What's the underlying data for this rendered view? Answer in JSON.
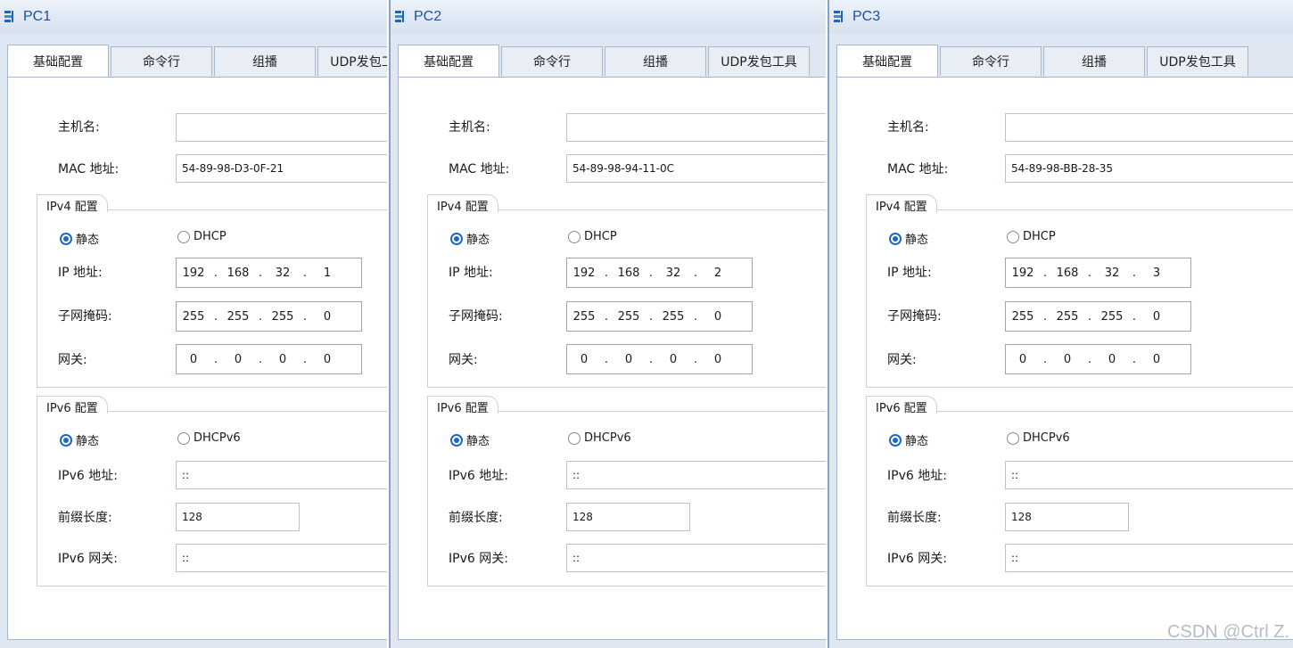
{
  "tabs": [
    "基础配置",
    "命令行",
    "组播",
    "UDP发包工具"
  ],
  "labels": {
    "hostname": "主机名:",
    "mac": "MAC 地址:",
    "ipv4_group": "IPv4 配置",
    "static": "静态",
    "dhcp": "DHCP",
    "ip": "IP 地址:",
    "mask": "子网掩码:",
    "gateway": "网关:",
    "ipv6_group": "IPv6 配置",
    "dhcpv6": "DHCPv6",
    "ipv6_addr": "IPv6 地址:",
    "prefix_len": "前缀长度:",
    "ipv6_gw": "IPv6 网关:"
  },
  "dot": ".",
  "windows": [
    {
      "title": "PC1",
      "hostname": "",
      "mac": "54-89-98-D3-0F-21",
      "ipv4_mode": "static",
      "ip": [
        "192",
        "168",
        "32",
        "1"
      ],
      "mask": [
        "255",
        "255",
        "255",
        "0"
      ],
      "gateway": [
        "0",
        "0",
        "0",
        "0"
      ],
      "ipv6_mode": "static",
      "ipv6_addr": "::",
      "prefix_len": "128",
      "ipv6_gw": "::"
    },
    {
      "title": "PC2",
      "hostname": "",
      "mac": "54-89-98-94-11-0C",
      "ipv4_mode": "static",
      "ip": [
        "192",
        "168",
        "32",
        "2"
      ],
      "mask": [
        "255",
        "255",
        "255",
        "0"
      ],
      "gateway": [
        "0",
        "0",
        "0",
        "0"
      ],
      "ipv6_mode": "static",
      "ipv6_addr": "::",
      "prefix_len": "128",
      "ipv6_gw": "::"
    },
    {
      "title": "PC3",
      "hostname": "",
      "mac": "54-89-98-BB-28-35",
      "ipv4_mode": "static",
      "ip": [
        "192",
        "168",
        "32",
        "3"
      ],
      "mask": [
        "255",
        "255",
        "255",
        "0"
      ],
      "gateway": [
        "0",
        "0",
        "0",
        "0"
      ],
      "ipv6_mode": "static",
      "ipv6_addr": "::",
      "prefix_len": "128",
      "ipv6_gw": "::"
    }
  ],
  "watermark": "CSDN @Ctrl Z.",
  "colors": {
    "accent": "#1c68c8",
    "title_text": "#1d4f9a",
    "window_bg": "#dfe8f2"
  },
  "icons": {
    "app": "network-pc-icon"
  }
}
